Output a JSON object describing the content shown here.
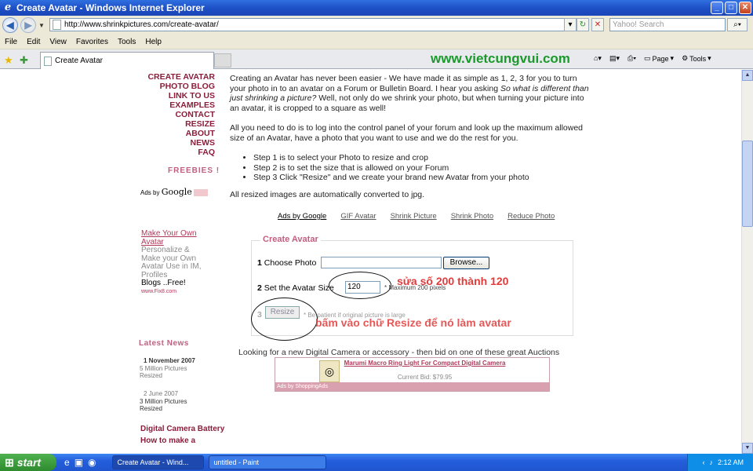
{
  "window": {
    "title": "Create Avatar - Windows Internet Explorer",
    "min": "_",
    "max": "□",
    "close": "✕"
  },
  "address": {
    "url": "http://www.shrinkpictures.com/create-avatar/",
    "search_placeholder": "Yahoo! Search"
  },
  "menu": [
    "File",
    "Edit",
    "View",
    "Favorites",
    "Tools",
    "Help"
  ],
  "tab": {
    "label": "Create Avatar"
  },
  "watermark": "www.vietcungvui.com",
  "toolbar": {
    "page": "Page",
    "tools": "Tools"
  },
  "nav": [
    "CREATE AVATAR",
    "PHOTO BLOG",
    "LINK TO US",
    "EXAMPLES",
    "CONTACT",
    "RESIZE",
    "ABOUT",
    "NEWS",
    "FAQ"
  ],
  "freebies": "FREEBIES !",
  "adsgoogle": {
    "label": "Ads by",
    "brand": "Google"
  },
  "sidead": {
    "title": "Make Your Own Avatar",
    "body": "Personalize & Make your Own Avatar Use in IM, Profiles",
    "blogs": "Blogs ..Free!",
    "url": "www.Fix8.com"
  },
  "latest": "Latest News",
  "news": [
    {
      "date": "1 November 2007",
      "text": "5 Million Pictures Resized"
    },
    {
      "date": "2 June 2007",
      "text": "3 Million Pictures Resized"
    }
  ],
  "sidelinks": [
    "Digital Camera Battery",
    "How to make a"
  ],
  "main": {
    "p1a": "Creating an Avatar has never been easier - We have made it as simple as 1, 2, 3 for you to turn your photo in to an avatar on a Forum or Bulletin Board.  I hear you asking ",
    "p1i": "So what is different than just shrinking a picture?",
    "p1b": "  Well, not only do we shrink your photo, but when turning your picture into an avatar, it is cropped to a square as well!",
    "p2": "All you need to do is to log into the control panel of your forum and look up the maximum allowed size of an Avatar, have a photo that you want to use and we do the rest for you.",
    "steps": [
      "Step 1 is to select your Photo to resize and crop",
      "Step 2 is to set the size that is allowed on your Forum",
      "Step 3 Click \"Resize\" and we create your brand new Avatar from your photo"
    ],
    "p3": "All resized images are automatically converted to jpg."
  },
  "links": [
    "Ads by Google",
    "GIF Avatar",
    "Shrink Picture",
    "Shrink Photo",
    "Reduce Photo"
  ],
  "form": {
    "legend": "Create Avatar",
    "step1_num": "1",
    "step1_label": "Choose Photo",
    "browse": "Browse...",
    "step2_num": "2",
    "step2_label": "Set the Avatar Size",
    "size_value": "120",
    "max": "* Maximum 200 pixels",
    "step3_num": "3",
    "resize": "Resize",
    "patient": "* Be patient if original picture is large"
  },
  "annotations": {
    "a1": "sửa số 200 thành 120",
    "a2": "bấm vào chữ Resize để nó làm avatar"
  },
  "auctions": "Looking for a new Digital Camera or accessory - then bid on one of these great Auctions",
  "ad": {
    "title": "Marumi Macro Ring Light For Compact Digital Camera",
    "bid": "Current Bid: $79.95",
    "footer": "Ads by ShoppingAds"
  },
  "taskbar": {
    "start": "start",
    "task1": "Create Avatar - Wind...",
    "task2": "untitled - Paint",
    "clock": "2:12 AM"
  }
}
